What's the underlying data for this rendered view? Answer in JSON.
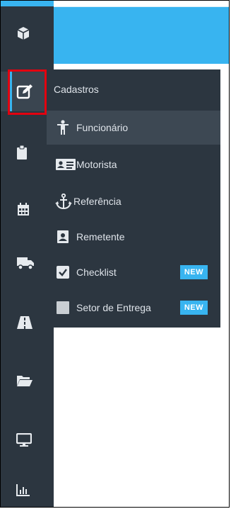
{
  "colors": {
    "accent": "#38b4f0",
    "sidebar_bg": "#2c3640",
    "highlight": "#e3000f"
  },
  "sidebar": {
    "icons": [
      {
        "name": "cube-icon"
      },
      {
        "name": "edit-icon",
        "active": true
      },
      {
        "name": "clipboard-icon"
      },
      {
        "name": "calendar-icon"
      },
      {
        "name": "truck-icon"
      },
      {
        "name": "road-icon"
      },
      {
        "name": "folder-open-icon"
      },
      {
        "name": "monitor-icon"
      },
      {
        "name": "bar-chart-icon"
      }
    ]
  },
  "submenu": {
    "header": "Cadastros",
    "items": [
      {
        "label": "Funcionário",
        "icon": "person-icon",
        "selected": true
      },
      {
        "label": "Motorista",
        "icon": "id-card-icon"
      },
      {
        "label": "Referência",
        "icon": "anchor-icon"
      },
      {
        "label": "Remetente",
        "icon": "contact-book-icon"
      },
      {
        "label": "Checklist",
        "icon": "checkbox-checked-icon",
        "badge": "NEW"
      },
      {
        "label": "Setor de Entrega",
        "icon": "square-icon",
        "badge": "NEW"
      }
    ]
  }
}
